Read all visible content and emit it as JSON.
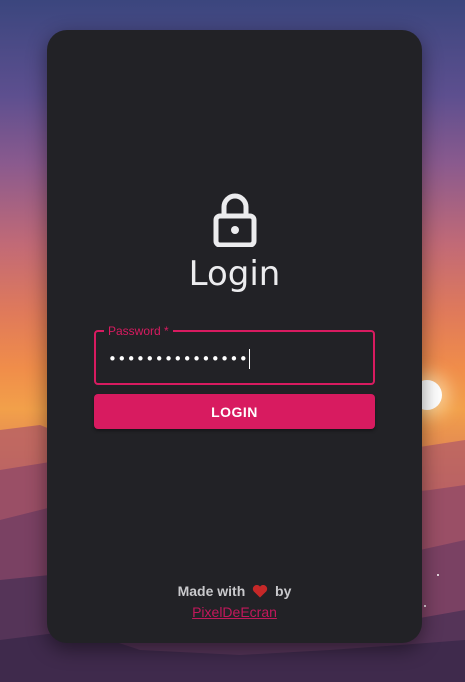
{
  "login": {
    "title": "Login",
    "password_label": "Password *",
    "password_value": "•••••••••••••••",
    "button_label": "LOGIN"
  },
  "footer": {
    "made_with": "Made with",
    "by": "by",
    "author": "PixelDeEcran"
  },
  "colors": {
    "accent": "#d81b60",
    "card": "#222226",
    "heart": "#c62828"
  },
  "icons": {
    "lock": "lock-icon",
    "heart": "heart-icon"
  }
}
